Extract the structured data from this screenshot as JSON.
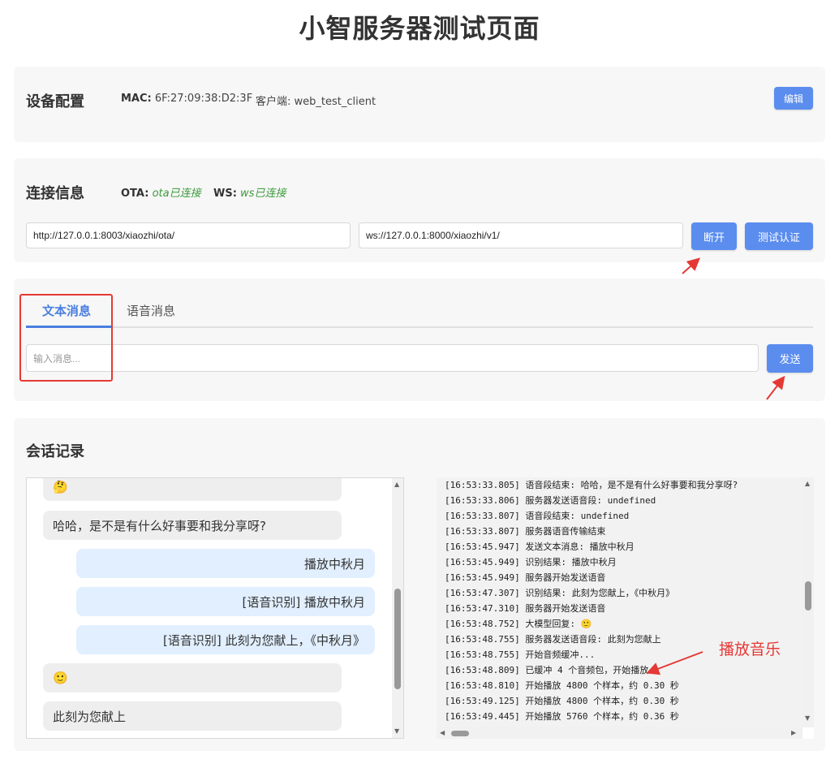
{
  "page": {
    "title": "小智服务器测试页面"
  },
  "device": {
    "section_title": "设备配置",
    "mac_label": "MAC:",
    "mac_value": "6F:27:09:38:D2:3F",
    "client_label": "客户端:",
    "client_value": "web_test_client",
    "edit_label": "编辑"
  },
  "connection": {
    "section_title": "连接信息",
    "ota_label": "OTA:",
    "ota_status": "ota已连接",
    "ws_label": "WS:",
    "ws_status": "ws已连接",
    "ota_url": "http://127.0.0.1:8003/xiaozhi/ota/",
    "ws_url": "ws://127.0.0.1:8000/xiaozhi/v1/",
    "disconnect_label": "断开",
    "test_auth_label": "测试认证"
  },
  "message": {
    "tabs": [
      {
        "label": "文本消息",
        "active": true
      },
      {
        "label": "语音消息",
        "active": false
      }
    ],
    "input_placeholder": "输入消息...",
    "send_label": "发送"
  },
  "conversation": {
    "section_title": "会话记录",
    "messages": [
      {
        "role": "ai",
        "text": "🤔"
      },
      {
        "role": "ai",
        "text": "哈哈，是不是有什么好事要和我分享呀?"
      },
      {
        "role": "user",
        "text": "播放中秋月"
      },
      {
        "role": "user",
        "text": "[语音识别] 播放中秋月"
      },
      {
        "role": "user",
        "text": "[语音识别] 此刻为您献上，《中秋月》"
      },
      {
        "role": "ai",
        "text": "🙂"
      },
      {
        "role": "ai",
        "text": "此刻为您献上"
      }
    ]
  },
  "log": {
    "lines": [
      "[16:53:33.805] 语音段结束: 哈哈，是不是有什么好事要和我分享呀?",
      "[16:53:33.806] 服务器发送语音段: undefined",
      "[16:53:33.807] 语音段结束: undefined",
      "[16:53:33.807] 服务器语音传输结束",
      "[16:53:45.947] 发送文本消息: 播放中秋月",
      "[16:53:45.949] 识别结果: 播放中秋月",
      "[16:53:45.949] 服务器开始发送语音",
      "[16:53:47.307] 识别结果: 此刻为您献上，《中秋月》",
      "[16:53:47.310] 服务器开始发送语音",
      "[16:53:48.752] 大模型回复: 🙂",
      "[16:53:48.755] 服务器发送语音段: 此刻为您献上",
      "[16:53:48.755] 开始音频缓冲...",
      "[16:53:48.809] 已缓冲 4 个音频包，开始播放",
      "[16:53:48.810] 开始播放 4800 个样本，约 0.30 秒",
      "[16:53:49.125] 开始播放 4800 个样本，约 0.30 秒",
      "[16:53:49.445] 开始播放 5760 个样本，约 0.36 秒"
    ]
  },
  "annotations": {
    "play_music": "播放音乐"
  },
  "colors": {
    "accent": "#5b8def",
    "success": "#3c9a3c",
    "annotation": "#e53935"
  }
}
